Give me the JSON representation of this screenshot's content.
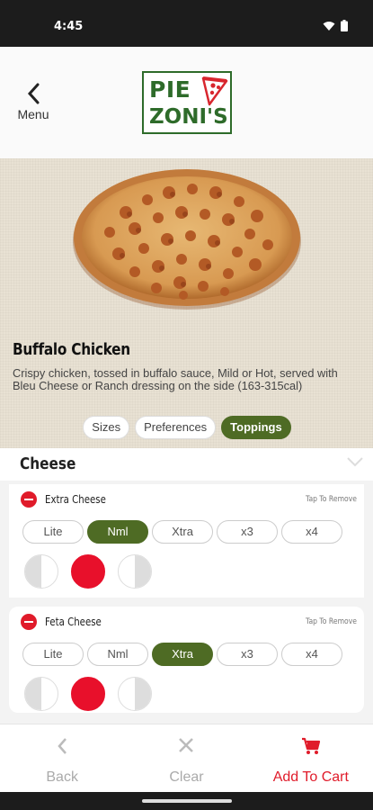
{
  "status": {
    "time": "4:45"
  },
  "header": {
    "back_label": "Menu",
    "logo_line1": "PIE",
    "logo_line2": "ZONI'S"
  },
  "item": {
    "title": "Buffalo Chicken",
    "description": "Crispy chicken, tossed in buffalo sauce, Mild or Hot, served with Bleu Cheese or Ranch dressing on the side (163-315cal)"
  },
  "tabs": [
    {
      "label": "Sizes",
      "active": false
    },
    {
      "label": "Preferences",
      "active": false
    },
    {
      "label": "Toppings",
      "active": true
    }
  ],
  "section": {
    "title": "Cheese"
  },
  "toppings": [
    {
      "name": "Extra Cheese",
      "tap_text": "Tap To Remove",
      "amounts": [
        "Lite",
        "Nml",
        "Xtra",
        "x3",
        "x4"
      ],
      "selected_amount": "Nml",
      "placement": "whole"
    },
    {
      "name": "Feta Cheese",
      "tap_text": "Tap To Remove",
      "amounts": [
        "Lite",
        "Nml",
        "Xtra",
        "x3",
        "x4"
      ],
      "selected_amount": "Xtra",
      "placement": "whole"
    }
  ],
  "bottom_nav": {
    "back": "Back",
    "clear": "Clear",
    "add": "Add To Cart"
  },
  "colors": {
    "brand_green": "#2e6b2a",
    "accent_green": "#4e6b24",
    "red": "#e01b2a"
  }
}
